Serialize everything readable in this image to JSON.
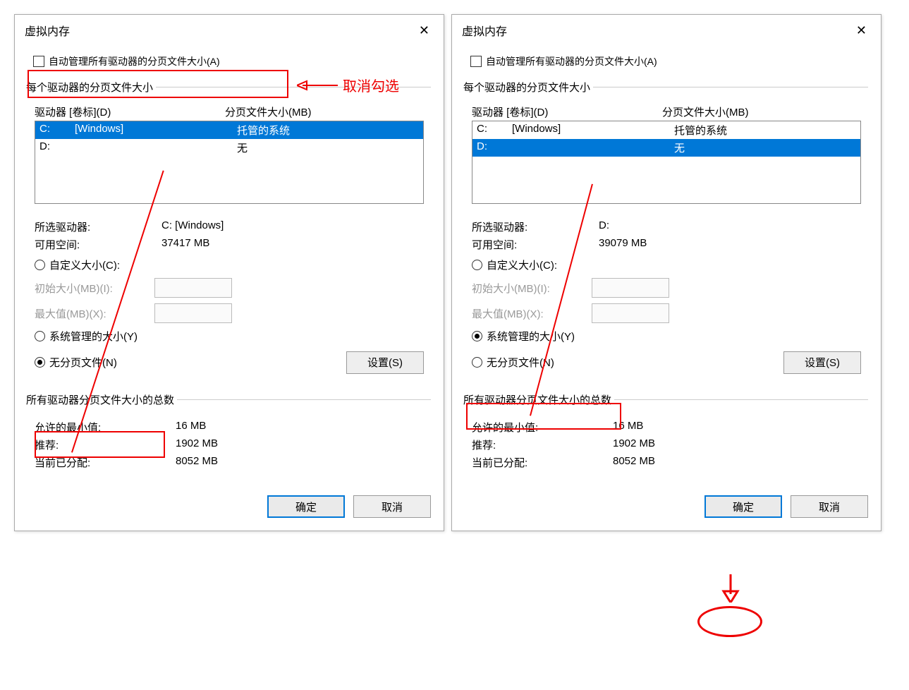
{
  "dialogs": [
    {
      "title": "虚拟内存",
      "auto_manage_label": "自动管理所有驱动器的分页文件大小(A)",
      "group1_legend": "每个驱动器的分页文件大小",
      "drive_col1": "驱动器 [卷标](D)",
      "drive_col2": "分页文件大小(MB)",
      "drives": [
        {
          "letter": "C:",
          "label": "[Windows]",
          "size": "托管的系统",
          "selected": true
        },
        {
          "letter": "D:",
          "label": "",
          "size": "无",
          "selected": false
        }
      ],
      "selected_drive_label": "所选驱动器:",
      "selected_drive_value": "C:  [Windows]",
      "free_space_label": "可用空间:",
      "free_space_value": "37417 MB",
      "custom_size_label": "自定义大小(C):",
      "initial_size_label": "初始大小(MB)(I):",
      "max_size_label": "最大值(MB)(X):",
      "system_managed_label": "系统管理的大小(Y)",
      "no_paging_label": "无分页文件(N)",
      "radio_selected": "no_paging",
      "set_button": "设置(S)",
      "group2_legend": "所有驱动器分页文件大小的总数",
      "min_allowed_label": "允许的最小值:",
      "min_allowed_value": "16 MB",
      "recommended_label": "推荐:",
      "recommended_value": "1902 MB",
      "current_label": "当前已分配:",
      "current_value": "8052 MB",
      "ok_button": "确定",
      "cancel_button": "取消",
      "annotations": {
        "uncheck_hint": "取消勾选",
        "no_paging_box": true,
        "auto_manage_box": true
      }
    },
    {
      "title": "虚拟内存",
      "auto_manage_label": "自动管理所有驱动器的分页文件大小(A)",
      "group1_legend": "每个驱动器的分页文件大小",
      "drive_col1": "驱动器 [卷标](D)",
      "drive_col2": "分页文件大小(MB)",
      "drives": [
        {
          "letter": "C:",
          "label": "[Windows]",
          "size": "托管的系统",
          "selected": false
        },
        {
          "letter": "D:",
          "label": "",
          "size": "无",
          "selected": true
        }
      ],
      "selected_drive_label": "所选驱动器:",
      "selected_drive_value": "D:",
      "free_space_label": "可用空间:",
      "free_space_value": "39079 MB",
      "custom_size_label": "自定义大小(C):",
      "initial_size_label": "初始大小(MB)(I):",
      "max_size_label": "最大值(MB)(X):",
      "system_managed_label": "系统管理的大小(Y)",
      "no_paging_label": "无分页文件(N)",
      "radio_selected": "system_managed",
      "set_button": "设置(S)",
      "group2_legend": "所有驱动器分页文件大小的总数",
      "min_allowed_label": "允许的最小值:",
      "min_allowed_value": "16 MB",
      "recommended_label": "推荐:",
      "recommended_value": "1902 MB",
      "current_label": "当前已分配:",
      "current_value": "8052 MB",
      "ok_button": "确定",
      "cancel_button": "取消",
      "annotations": {
        "system_managed_box": true,
        "ok_circle": true
      }
    }
  ]
}
